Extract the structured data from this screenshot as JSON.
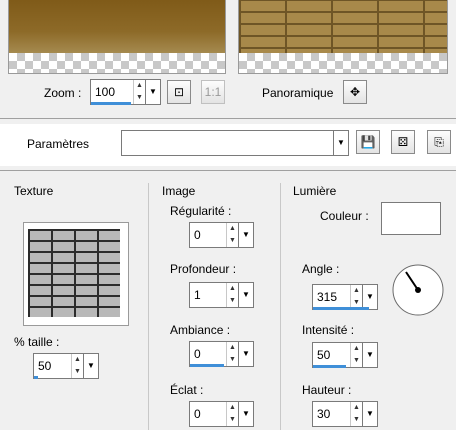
{
  "zoom": {
    "label": "Zoom :",
    "value": "100"
  },
  "pan": {
    "label": "Panoramique"
  },
  "params": {
    "label": "Paramètres",
    "value": ""
  },
  "texture": {
    "title": "Texture",
    "size_label": "% taille :",
    "size_value": "50"
  },
  "image": {
    "title": "Image",
    "regularity_label": "Régularité :",
    "regularity_value": "0",
    "depth_label": "Profondeur :",
    "depth_value": "1",
    "ambient_label": "Ambiance :",
    "ambient_value": "0",
    "shine_label": "Éclat :",
    "shine_value": "0"
  },
  "light": {
    "title": "Lumière",
    "color_label": "Couleur :",
    "angle_label": "Angle :",
    "angle_value": "315",
    "intensity_label": "Intensité :",
    "intensity_value": "50",
    "height_label": "Hauteur :",
    "height_value": "30"
  },
  "colors": {
    "slider_blue": "#3f8fd8",
    "light_color": "#ffffff"
  }
}
